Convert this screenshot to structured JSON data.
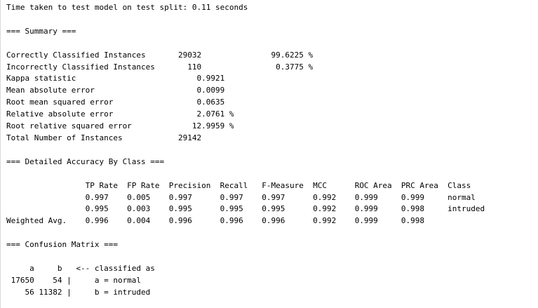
{
  "output": {
    "lines": [
      "Time taken to test model on test split: 0.11 seconds",
      "",
      "=== Summary ===",
      "",
      "Correctly Classified Instances       29032               99.6225 %",
      "Incorrectly Classified Instances       110                0.3775 %",
      "Kappa statistic                          0.9921",
      "Mean absolute error                      0.0099",
      "Root mean squared error                  0.0635",
      "Relative absolute error                  2.0761 %",
      "Root relative squared error             12.9959 %",
      "Total Number of Instances            29142",
      "",
      "=== Detailed Accuracy By Class ===",
      "",
      "                 TP Rate  FP Rate  Precision  Recall   F-Measure  MCC      ROC Area  PRC Area  Class",
      "                 0.997    0.005    0.997      0.997    0.997      0.992    0.999     0.999     normal",
      "                 0.995    0.003    0.995      0.995    0.995      0.992    0.999     0.998     intruded",
      "Weighted Avg.    0.996    0.004    0.996      0.996    0.996      0.992    0.999     0.998",
      "",
      "=== Confusion Matrix ===",
      "",
      "     a     b   <-- classified as",
      " 17650    54 |     a = normal",
      "    56 11382 |     b = intruded"
    ]
  }
}
